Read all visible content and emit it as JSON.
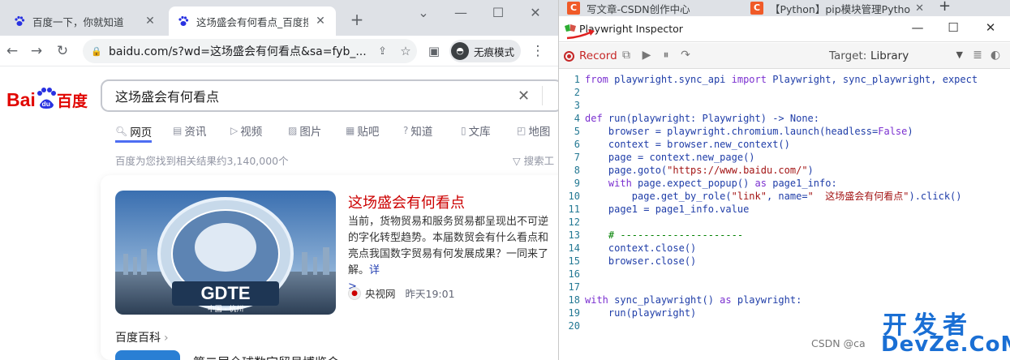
{
  "browser": {
    "tabs": [
      {
        "title": "百度一下，你就知道"
      },
      {
        "title": "这场盛会有何看点_百度搜索"
      }
    ],
    "new_tab": "+",
    "url": "baidu.com/s?wd=这场盛会有何看点&sa=fyb_...",
    "incognito_label": "无痕模式"
  },
  "baidu": {
    "logo_text": "Bai百度",
    "query": "这场盛会有何看点",
    "nav": [
      "网页",
      "资讯",
      "视频",
      "图片",
      "贴吧",
      "知道",
      "文库",
      "地图"
    ],
    "stats": "百度为您找到相关结果约3,140,000个",
    "tools": "搜索工",
    "result": {
      "title": "这场盛会有何看点",
      "abstract": "当前，货物贸易和服务贸易都呈现出不可逆的字化转型趋势。本届数贸会有什么看点和亮点我国数字贸易有何发展成果？一同来了解。",
      "more": "详",
      "arrow": ">",
      "source": "央视网",
      "time": "昨天19:01",
      "image_text": "GDTE",
      "image_sub": "中国 · 杭州"
    },
    "baike": "百度百科",
    "baike_next": "第二届全球数字贸易博览会"
  },
  "right_tabs": [
    {
      "title": "写文章-CSDN创作中心"
    },
    {
      "title": "【Python】pip模块管理Pytho"
    }
  ],
  "inspector": {
    "title": "Playwright Inspector",
    "record": "Record",
    "target_label": "Target:",
    "target_value": "Library"
  },
  "code_lines": [
    {
      "n": "1"
    },
    {
      "n": "2"
    },
    {
      "n": "3"
    },
    {
      "n": "4"
    },
    {
      "n": "5"
    },
    {
      "n": "6"
    },
    {
      "n": "7"
    },
    {
      "n": "8"
    },
    {
      "n": "9"
    },
    {
      "n": "10"
    },
    {
      "n": "11"
    },
    {
      "n": "12"
    },
    {
      "n": "13"
    },
    {
      "n": "14"
    },
    {
      "n": "15"
    },
    {
      "n": "16"
    },
    {
      "n": "17"
    },
    {
      "n": "18"
    },
    {
      "n": "19"
    },
    {
      "n": "20"
    }
  ],
  "code": {
    "l1a": "from ",
    "l1b": "playwright.sync_api ",
    "l1c": "import ",
    "l1d": "Playwright, sync_playwright, expect",
    "l4a": "def ",
    "l4b": "run(playwright: Playwright) -> None:",
    "l5": "browser = playwright.chromium.launch(headless=",
    "l5b": "False",
    "l5c": ")",
    "l6": "context = browser.new_context()",
    "l7": "page = context.new_page()",
    "l8a": "page.goto(",
    "l8b": "\"https://www.baidu.com/\"",
    "l8c": ")",
    "l9a": "with ",
    "l9b": "page.expect_popup() ",
    "l9c": "as ",
    "l9d": "page1_info:",
    "l10a": "page.get_by_role(",
    "l10b": "\"link\"",
    "l10c": ", name=",
    "l10d": "\"  这场盛会有何看点\"",
    "l10e": ").click()",
    "l11": "page1 = page1_info.value",
    "l13": "# ---------------------",
    "l14": "context.close()",
    "l15": "browser.close()",
    "l18a": "with ",
    "l18b": "sync_playwright() ",
    "l18c": "as ",
    "l18d": "playwright:",
    "l19": "run(playwright)"
  },
  "watermark": {
    "csdn": "CSDN @ca",
    "line1": "开发者",
    "line2": "DevZe.CoM"
  }
}
